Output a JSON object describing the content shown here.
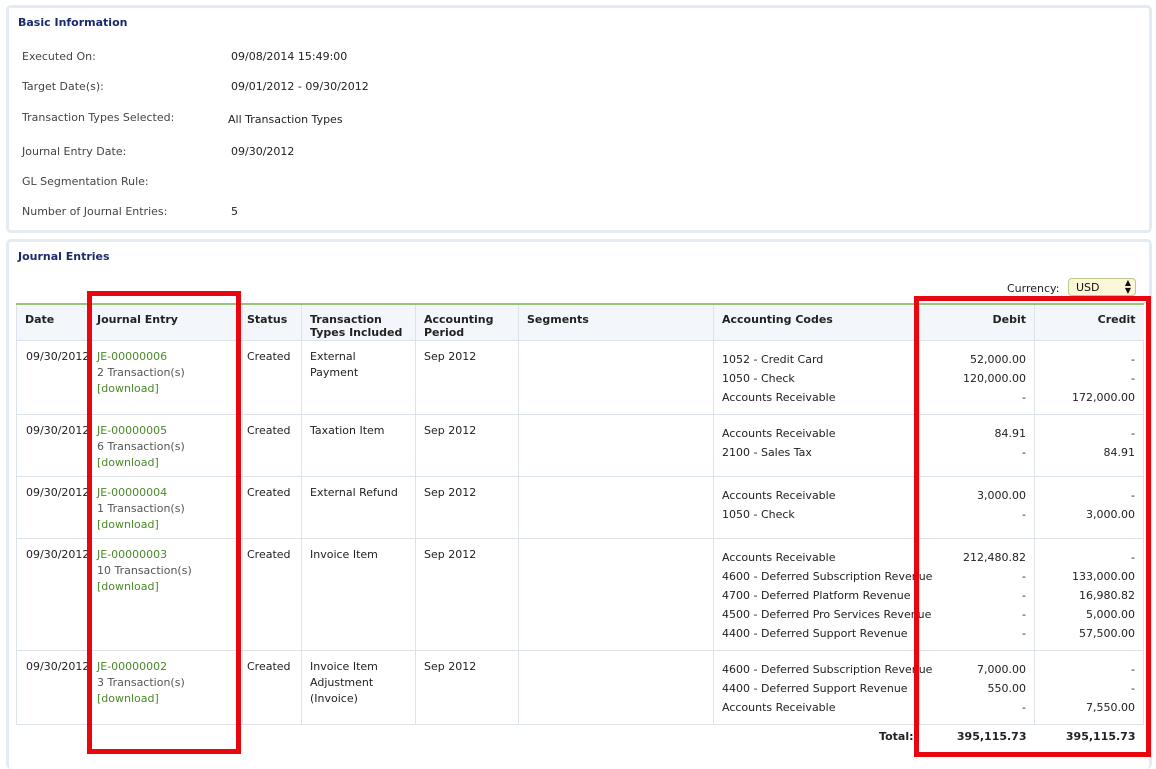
{
  "basic": {
    "title": "Basic Information",
    "rows": [
      {
        "label": "Executed On:",
        "value": "09/08/2014 15:49:00"
      },
      {
        "label": "Target Date(s):",
        "value": "09/01/2012 - 09/30/2012"
      },
      {
        "label": "Transaction Types Selected:",
        "value": "All Transaction Types"
      },
      {
        "label": "Journal Entry Date:",
        "value": "09/30/2012"
      },
      {
        "label": "GL Segmentation Rule:",
        "value": ""
      },
      {
        "label": "Number of Journal Entries:",
        "value": "5"
      }
    ]
  },
  "journal": {
    "title": "Journal Entries",
    "currency_label": "Currency:",
    "currency_value": "USD",
    "headers": {
      "date": "Date",
      "journal_entry": "Journal Entry",
      "status": "Status",
      "types_line1": "Transaction",
      "types_line2": "Types Included",
      "period_line1": "Accounting",
      "period_line2": "Period",
      "segments": "Segments",
      "codes": "Accounting Codes",
      "debit": "Debit",
      "credit": "Credit"
    },
    "entries": [
      {
        "date": "09/30/2012",
        "id": "JE-00000006",
        "count": "2 Transaction(s)",
        "download": "[download]",
        "status": "Created",
        "types": [
          "External Payment"
        ],
        "period": "Sep 2012",
        "codes": [
          "1052 - Credit Card",
          "1050 - Check",
          "Accounts Receivable"
        ],
        "debit": [
          "52,000.00",
          "120,000.00",
          "-"
        ],
        "credit": [
          "-",
          "-",
          "172,000.00"
        ]
      },
      {
        "date": "09/30/2012",
        "id": "JE-00000005",
        "count": "6 Transaction(s)",
        "download": "[download]",
        "status": "Created",
        "types": [
          "Taxation Item"
        ],
        "period": "Sep 2012",
        "codes": [
          "Accounts Receivable",
          "2100 - Sales Tax"
        ],
        "debit": [
          "84.91",
          "-"
        ],
        "credit": [
          "-",
          "84.91"
        ]
      },
      {
        "date": "09/30/2012",
        "id": "JE-00000004",
        "count": "1 Transaction(s)",
        "download": "[download]",
        "status": "Created",
        "types": [
          "External Refund"
        ],
        "period": "Sep 2012",
        "codes": [
          "Accounts Receivable",
          "1050 - Check"
        ],
        "debit": [
          "3,000.00",
          "-"
        ],
        "credit": [
          "-",
          "3,000.00"
        ]
      },
      {
        "date": "09/30/2012",
        "id": "JE-00000003",
        "count": "10 Transaction(s)",
        "download": "[download]",
        "status": "Created",
        "types": [
          "Invoice Item"
        ],
        "period": "Sep 2012",
        "codes": [
          "Accounts Receivable",
          "4600 - Deferred Subscription Revenue",
          "4700 - Deferred Platform Revenue",
          "4500 - Deferred Pro Services Revenue",
          "4400 - Deferred Support Revenue"
        ],
        "debit": [
          "212,480.82",
          "-",
          "-",
          "-",
          "-"
        ],
        "credit": [
          "-",
          "133,000.00",
          "16,980.82",
          "5,000.00",
          "57,500.00"
        ]
      },
      {
        "date": "09/30/2012",
        "id": "JE-00000002",
        "count": "3 Transaction(s)",
        "download": "[download]",
        "status": "Created",
        "types": [
          "Invoice Item",
          "Adjustment",
          "(Invoice)"
        ],
        "period": "Sep 2012",
        "codes": [
          "4600 - Deferred Subscription Revenue",
          "4400 - Deferred Support Revenue",
          "Accounts Receivable"
        ],
        "debit": [
          "7,000.00",
          "550.00",
          "-"
        ],
        "credit": [
          "-",
          "-",
          "7,550.00"
        ]
      }
    ],
    "total_label": "Total:",
    "total_debit": "395,115.73",
    "total_credit": "395,115.73"
  },
  "colors": {
    "highlight": "#e8060f",
    "link": "#4a8a2a",
    "title": "#1a2a6c"
  }
}
